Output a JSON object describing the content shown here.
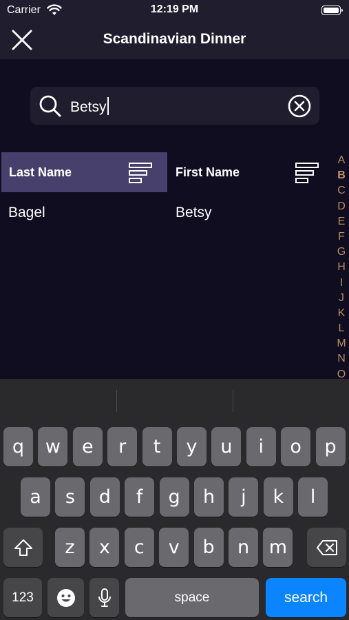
{
  "status": {
    "carrier": "Carrier",
    "time": "12:19 PM"
  },
  "nav": {
    "title": "Scandinavian Dinner"
  },
  "search": {
    "value": "Betsy"
  },
  "table": {
    "headers": [
      {
        "label": "Last Name",
        "active": true
      },
      {
        "label": "First Name",
        "active": false
      }
    ],
    "rows": [
      {
        "last": "Bagel",
        "first": "Betsy"
      }
    ]
  },
  "index": {
    "letters": [
      "A",
      "B",
      "C",
      "D",
      "E",
      "F",
      "G",
      "H",
      "I",
      "J",
      "K",
      "L",
      "M",
      "N",
      "O"
    ],
    "highlighted": "B"
  },
  "keyboard": {
    "row1": [
      "q",
      "w",
      "e",
      "r",
      "t",
      "y",
      "u",
      "i",
      "o",
      "p"
    ],
    "row2": [
      "a",
      "s",
      "d",
      "f",
      "g",
      "h",
      "j",
      "k",
      "l"
    ],
    "row3": [
      "z",
      "x",
      "c",
      "v",
      "b",
      "n",
      "m"
    ],
    "numbers_label": "123",
    "space_label": "space",
    "action_label": "search"
  },
  "colors": {
    "background": "#0f0d1f",
    "bar": "#1f1d2e",
    "active_header": "#47406c",
    "index_letter": "#b98c62",
    "search_key": "#0a84ff"
  },
  "icons": [
    "wifi-icon",
    "battery-icon",
    "close-icon",
    "search-icon",
    "clear-icon",
    "sort-icon",
    "shift-icon",
    "delete-icon",
    "emoji-icon",
    "microphone-icon"
  ]
}
